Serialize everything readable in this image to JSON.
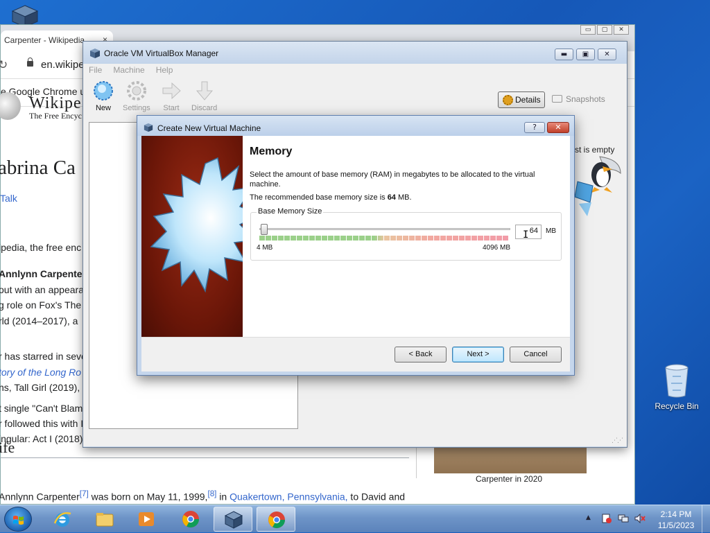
{
  "desktop": {
    "recycle_bin_label": "Recycle Bin"
  },
  "chrome": {
    "tab_title": "Carpenter - Wikipedia",
    "tab_close": "×",
    "url": "en.wikipe",
    "info_bar": "e Google Chrome up",
    "window_buttons": [
      "▭",
      "▢",
      "✕"
    ]
  },
  "wiki": {
    "wordmark": "Wikipe",
    "tagline": "The Free Encyc",
    "heading": "abrina Ca",
    "talk": "Talk",
    "lines": [
      "ipedia, the free enc",
      "Annlynn Carpenter",
      "out with an appeara",
      "g role on Fox's The",
      "rld (2014–2017), a",
      "r has starred in seve",
      "tory of the Long Ro",
      "ns, Tall Girl (2019),",
      "t single \"Can't Blam",
      "r followed this with I",
      "ingular: Act I (2018)"
    ],
    "section": "ife",
    "life_text_a": "Annlynn Carpenter",
    "life_sup1": "[7]",
    "life_text_b": " was born on May 11, 1999,",
    "life_sup2": "[8]",
    "life_text_c": " in ",
    "life_link": "Quakertown, Pennsylvania,",
    "life_text_d": " to David and",
    "caption": "Carpenter in 2020"
  },
  "vbm": {
    "title": "Oracle VM VirtualBox Manager",
    "window_buttons": [
      "▬",
      "▣",
      "✕"
    ],
    "menu": [
      "File",
      "Machine",
      "Help"
    ],
    "toolbar": [
      {
        "label": "New",
        "icon": "new-icon"
      },
      {
        "label": "Settings",
        "icon": "gear-icon"
      },
      {
        "label": "Start",
        "icon": "arrow-right-icon"
      },
      {
        "label": "Discard",
        "icon": "arrow-down-icon"
      }
    ],
    "details_label": "Details",
    "snapshots_label": "Snapshots",
    "empty_text": "st is empty"
  },
  "dialog": {
    "title": "Create New Virtual Machine",
    "help_label": "?",
    "close_label": "✕",
    "heading": "Memory",
    "description": "Select the amount of base memory (RAM) in megabytes to be allocated to the virtual machine.",
    "recommended_prefix": "The recommended base memory size is ",
    "recommended_value": "64",
    "recommended_suffix": " MB.",
    "group_label": "Base Memory Size",
    "slider_min_label": "4 MB",
    "slider_max_label": "4096 MB",
    "memory_value": "64",
    "memory_unit": "MB",
    "buttons": {
      "back": "< Back",
      "next": "Next >",
      "cancel": "Cancel"
    }
  },
  "taskbar": {
    "time": "2:14 PM",
    "date": "11/5/2023",
    "tray_arrow": "▲"
  },
  "colors": {
    "desktop": "#1658b8",
    "link": "#3366cc",
    "dialog_art": "#6a1608"
  }
}
